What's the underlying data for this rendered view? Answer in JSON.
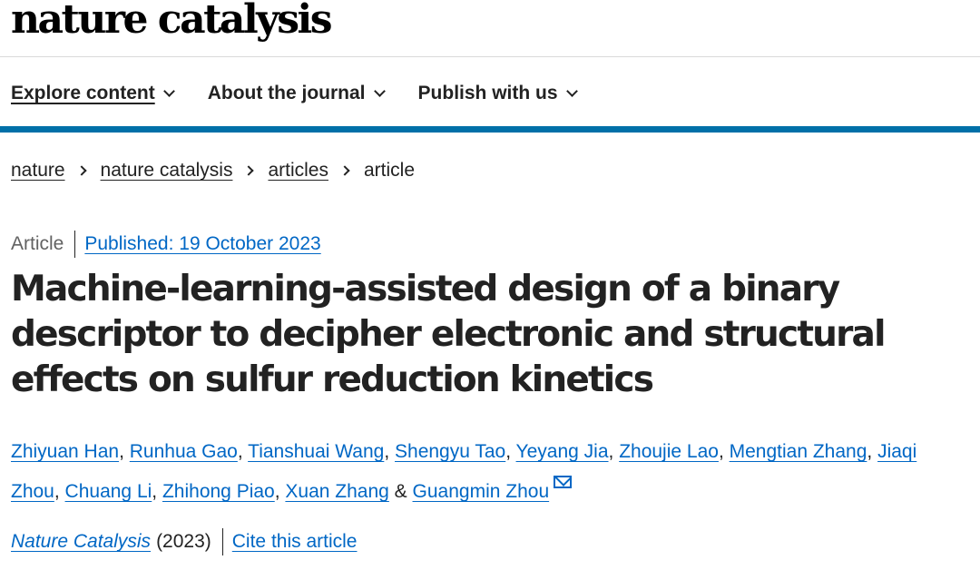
{
  "site": {
    "logo": "nature catalysis"
  },
  "nav": {
    "items": [
      {
        "label": "Explore content",
        "active": true
      },
      {
        "label": "About the journal",
        "active": false
      },
      {
        "label": "Publish with us",
        "active": false
      }
    ]
  },
  "breadcrumb": [
    "nature",
    "nature catalysis",
    "articles",
    "article"
  ],
  "article": {
    "type": "Article",
    "published": "Published: 19 October 2023",
    "title": "Machine-learning-assisted design of a binary descriptor to decipher electronic and structural effects on sulfur reduction kinetics",
    "authors": [
      "Zhiyuan Han",
      "Runhua Gao",
      "Tianshuai Wang",
      "Shengyu Tao",
      "Yeyang Jia",
      "Zhoujie Lao",
      "Mengtian Zhang",
      "Jiaqi Zhou",
      "Chuang Li",
      "Zhihong Piao",
      "Xuan Zhang",
      "Guangmin Zhou"
    ],
    "author_separator": ", ",
    "last_author_separator": " & ",
    "journal": "Nature Catalysis",
    "year": "(2023)",
    "cite_label": "Cite this article"
  },
  "colors": {
    "accent_bar": "#0070a8",
    "link": "#0067c5",
    "text": "#222222"
  },
  "icons": {
    "nav_dropdown": "chevron-down-icon",
    "breadcrumb_separator": "chevron-right-icon",
    "corresponding_author": "mail-icon"
  }
}
